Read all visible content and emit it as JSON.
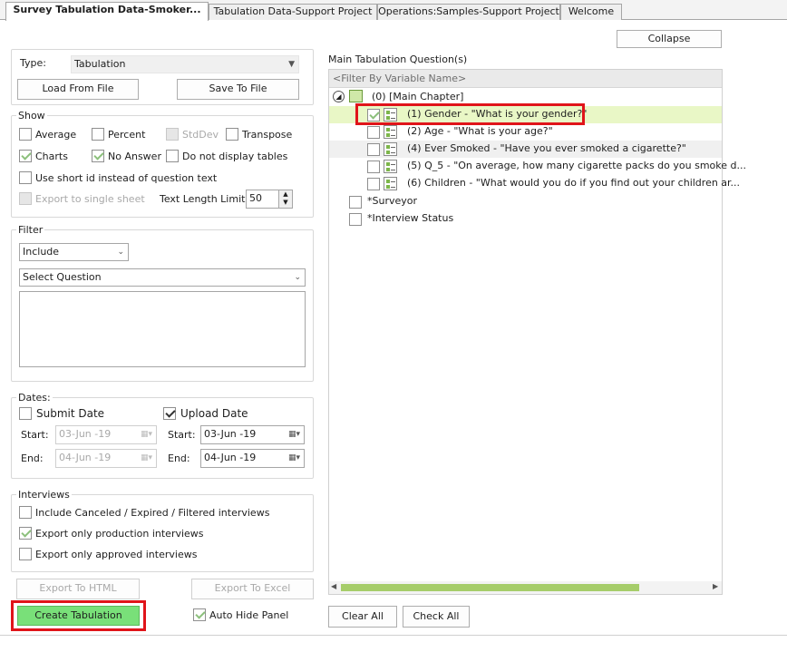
{
  "tabs": [
    {
      "label": "Survey Tabulation Data-Smoker..."
    },
    {
      "label": "Tabulation Data-Support Project"
    },
    {
      "label": "Operations:Samples-Support Project"
    },
    {
      "label": "Welcome"
    }
  ],
  "collapse_label": "Collapse",
  "type": {
    "label": "Type:",
    "value": "Tabulation"
  },
  "load_from_file": "Load From File",
  "save_to_file": "Save To File",
  "show": {
    "title": "Show",
    "average": "Average",
    "percent": "Percent",
    "stddev": "StdDev",
    "transpose": "Transpose",
    "charts": "Charts",
    "no_answer": "No Answer",
    "do_not_display_tables": "Do not display tables",
    "use_short_id": "Use short id instead of question text",
    "export_single_sheet": "Export to single sheet",
    "text_length_label": "Text Length Limit",
    "text_length_value": "50"
  },
  "filter": {
    "title": "Filter",
    "mode": "Include",
    "question_placeholder": "Select Question"
  },
  "dates": {
    "title": "Dates:",
    "submit_date": "Submit Date",
    "upload_date": "Upload Date",
    "start_label": "Start:",
    "end_label": "End:",
    "submit_start": "03-Jun -19",
    "submit_end": "04-Jun -19",
    "upload_start": "03-Jun -19",
    "upload_end": "04-Jun -19"
  },
  "interviews": {
    "title": "Interviews",
    "include_canceled": "Include Canceled / Expired / Filtered interviews",
    "export_production": "Export only production interviews",
    "export_approved": "Export only approved interviews"
  },
  "export_html": "Export To HTML",
  "export_excel": "Export To Excel",
  "create_tabulation": "Create Tabulation",
  "auto_hide_panel": "Auto Hide Panel",
  "main_questions_title": "Main Tabulation Question(s)",
  "filter_by_variable": "<Filter By Variable Name>",
  "tree": {
    "chapter": "(0)  [Main Chapter]",
    "q1": "(1)  Gender - \"What is your gender?\"",
    "q2": "(2)  Age - \"What is your age?\"",
    "q4": "(4)  Ever Smoked - \"Have you ever smoked a cigarette?\"",
    "q5": "(5)  Q_5 - \"On average, how many cigarette packs do you smoke d...",
    "q6": "(6)  Children - \"What would you do if you find out your children ar...",
    "surveyor": "*Surveyor",
    "interview_status": "*Interview Status"
  },
  "clear_all": "Clear All",
  "check_all": "Check All",
  "colors": {
    "highlight_red": "#e0141a",
    "create_green": "#79e079",
    "selected_row": "#e9f7c6",
    "scroll_thumb": "#a6cd6a"
  }
}
